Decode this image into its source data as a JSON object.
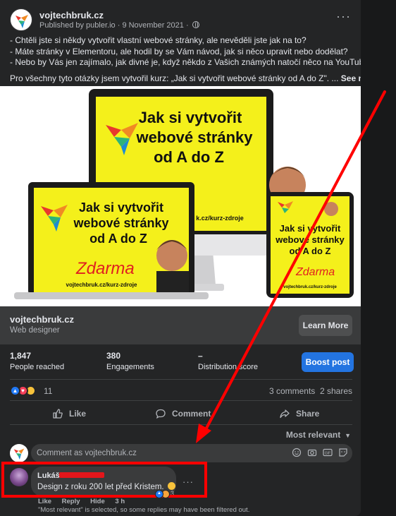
{
  "post": {
    "page_name": "vojtechbruk.cz",
    "published_by": "Published by publer.io",
    "date": "9 November 2021",
    "text_lines": [
      "- Chtěli jste si někdy vytvořit vlastní webové stránky, ale nevěděli jste jak na to?",
      "- Máte stránky v Elementoru, ale hodil by se Vám návod, jak si něco upravit nebo dodělat?",
      "- Nebo by Vás jen zajímalo, jak divné je, když někdo z Vašich známých natočí něco na YouTube?"
    ],
    "text_last": "Pro všechny tyto otázky jsem vytvořil kurz: „Jak si vytvořit webové stránky od A do Z\". ...",
    "see_more": "See more"
  },
  "image": {
    "headline_big": [
      "Jak si vytvořit",
      "webové stránky",
      "od A do Z"
    ],
    "url_text": "vojtechbruk.cz/kurz-zdroje",
    "url_partial": "k.cz/kurz-zdroje",
    "script_text": "Zdarma"
  },
  "link_preview": {
    "title": "vojtechbruk.cz",
    "subtitle": "Web designer",
    "button": "Learn More"
  },
  "insights": {
    "reached_value": "1,847",
    "reached_label": "People reached",
    "engagements_value": "380",
    "engagements_label": "Engagements",
    "distribution_value": "–",
    "distribution_label": "Distribution score",
    "boost_button": "Boost post"
  },
  "reactions": {
    "count": "11",
    "comments": "3 comments",
    "shares": "2 shares"
  },
  "actions": {
    "like": "Like",
    "comment": "Comment",
    "share": "Share"
  },
  "sort": {
    "label": "Most relevant"
  },
  "comment_input": {
    "placeholder": "Comment as vojtechbruk.cz"
  },
  "comment": {
    "author": "Lukáš",
    "text": "Design z roku 200 let před Kristem.",
    "reaction_count": "3",
    "actions": [
      "Like",
      "Reply",
      "Hide",
      "3 h"
    ],
    "filter_note": "\"Most relevant\" is selected, so some replies may have been filtered out."
  },
  "colors": {
    "background": "#18191a",
    "card": "#242526",
    "accent_blue": "#2374e1",
    "annotation_red": "#ff0000",
    "promo_yellow": "#f4f01b"
  }
}
